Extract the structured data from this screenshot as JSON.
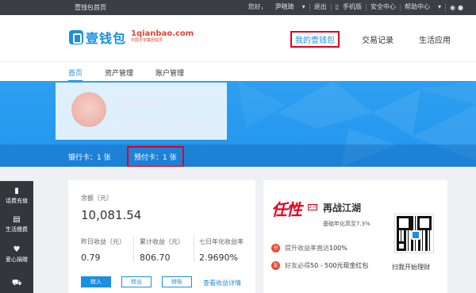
{
  "topbar": {
    "home": "壹钱包首页",
    "greeting": "您好，",
    "username": "尹晓琦",
    "logout": "退出",
    "mobile": "手机版",
    "security": "安全中心",
    "help": "帮助中心",
    "weibo_icon": "weibo-icon",
    "wechat_icon": "wechat-icon"
  },
  "header": {
    "logo_text": "壹钱包",
    "logo_domain": "1qianbao.com",
    "logo_tagline": "中国平安集团成员",
    "nav": [
      {
        "label": "我的壹钱包",
        "active": true
      },
      {
        "label": "交易记录",
        "active": false
      },
      {
        "label": "生活应用",
        "active": false
      }
    ]
  },
  "subnav": {
    "items": [
      {
        "label": "首页",
        "active": true
      },
      {
        "label": "资产管理",
        "active": false
      },
      {
        "label": "账户管理",
        "active": false
      }
    ]
  },
  "banner": {
    "bank_card": "银行卡：1 张",
    "prepaid_card": "预付卡：1 张"
  },
  "sidebar": {
    "items": [
      {
        "label": "话费充值",
        "icon": "phone-icon"
      },
      {
        "label": "生活缴费",
        "icon": "bills-icon"
      },
      {
        "label": "爱心捐赠",
        "icon": "heart-icon"
      },
      {
        "label": "",
        "icon": "cart-icon"
      }
    ]
  },
  "balance": {
    "label": "余额（元）",
    "value": "10,081.54",
    "yesterday_label": "昨日收益（元）",
    "yesterday_value": "0.79",
    "total_label": "累计收益（元）",
    "total_value": "806.70",
    "annual_label": "七日年化收益率",
    "annual_value": "2.9690%",
    "btn_in": "转入",
    "btn_out": "转出",
    "btn_transfer": "转账",
    "earn_link": "查看收益详情"
  },
  "promo": {
    "big": "任性",
    "badge": "2.0",
    "title": "再战江湖",
    "subtitle": "基础年化高至7.3%",
    "row1_prefix": "提升收益率直达",
    "row1_em": "100%",
    "row2_prefix": "好友必得",
    "row2_em": "50 - 500元现金红包",
    "row1_dot": "分",
    "row2_dot": "友",
    "qr_caption": "扫我开始理财"
  },
  "colors": {
    "brand_blue": "#1a8fe3",
    "highlight_red": "#e3001b",
    "topbar": "#3b3f45",
    "sidebar": "#33363b"
  }
}
